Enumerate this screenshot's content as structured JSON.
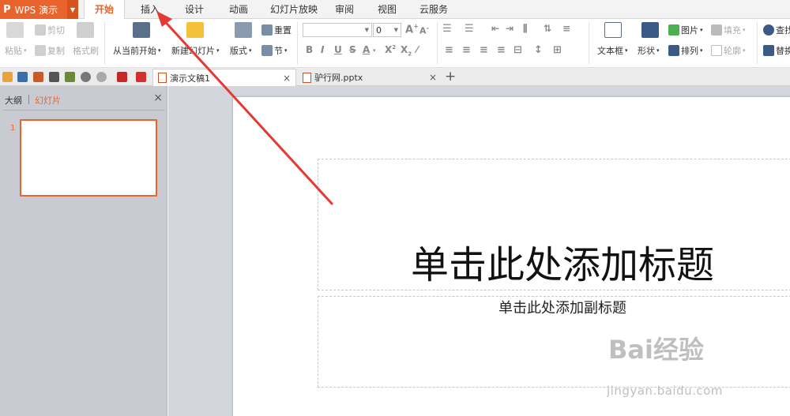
{
  "app": {
    "logo": "P",
    "name": "WPS 演示"
  },
  "menu_tabs": [
    "开始",
    "插入",
    "设计",
    "动画",
    "幻灯片放映",
    "审阅",
    "视图",
    "云服务"
  ],
  "ribbon": {
    "paste": "粘贴",
    "cut": "剪切",
    "copy": "复制",
    "format_painter": "格式刷",
    "from_current": "从当前开始",
    "new_slide": "新建幻灯片",
    "layout": "版式",
    "reset": "重置",
    "section": "节",
    "font_size": "0",
    "text_box": "文本框",
    "shape": "形状",
    "picture": "图片",
    "fill": "填充",
    "arrange": "排列",
    "outline": "轮廓",
    "find": "查找",
    "replace": "替换"
  },
  "doc_tabs": [
    {
      "name": "演示文稿1",
      "active": true
    },
    {
      "name": "驴行网.pptx",
      "active": false
    }
  ],
  "left_panel": {
    "tab_outline": "大纲",
    "tab_slides": "幻灯片",
    "slide_number": "1"
  },
  "slide": {
    "title_placeholder": "单击此处添加标题",
    "subtitle_placeholder": "单击此处添加副标题"
  },
  "watermark": {
    "brand": "Bai经验",
    "url": "jingyan.baidu.com"
  },
  "colors": {
    "accent": "#e8642c",
    "arrow": "#e53935"
  }
}
